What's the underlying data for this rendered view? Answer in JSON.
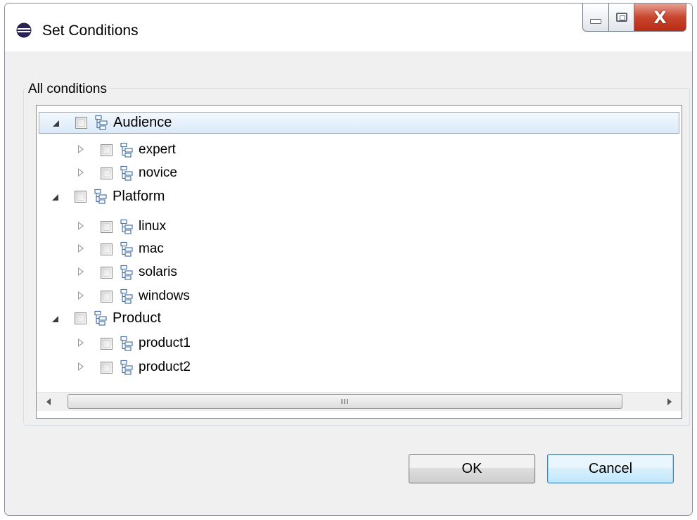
{
  "window": {
    "title": "Set Conditions",
    "icon": "eclipse-icon",
    "controls": [
      "minimize-icon",
      "maximize-icon",
      "close-icon"
    ],
    "close_glyph": "X"
  },
  "group": {
    "label": "All conditions"
  },
  "tree": {
    "nodes": [
      {
        "label": "Audience",
        "level": 0,
        "expanded": true,
        "checked": false,
        "selected": true
      },
      {
        "label": "expert",
        "level": 1,
        "expanded": false,
        "checked": false
      },
      {
        "label": "novice",
        "level": 1,
        "expanded": false,
        "checked": false
      },
      {
        "label": "Platform",
        "level": 0,
        "expanded": true,
        "checked": false
      },
      {
        "label": "linux",
        "level": 1,
        "expanded": false,
        "checked": false
      },
      {
        "label": "mac",
        "level": 1,
        "expanded": false,
        "checked": false
      },
      {
        "label": "solaris",
        "level": 1,
        "expanded": false,
        "checked": false
      },
      {
        "label": "windows",
        "level": 1,
        "expanded": false,
        "checked": false
      },
      {
        "label": "Product",
        "level": 0,
        "expanded": true,
        "checked": false
      },
      {
        "label": "product1",
        "level": 1,
        "expanded": false,
        "checked": false
      },
      {
        "label": "product2",
        "level": 1,
        "expanded": false,
        "checked": false
      }
    ],
    "scrollbar_grip": "III"
  },
  "buttons": {
    "ok": "OK",
    "cancel": "Cancel"
  },
  "colors": {
    "selection": "#dbeaf9",
    "cancel_focus": "#3c7fb1",
    "close_button": "#c9452e"
  }
}
